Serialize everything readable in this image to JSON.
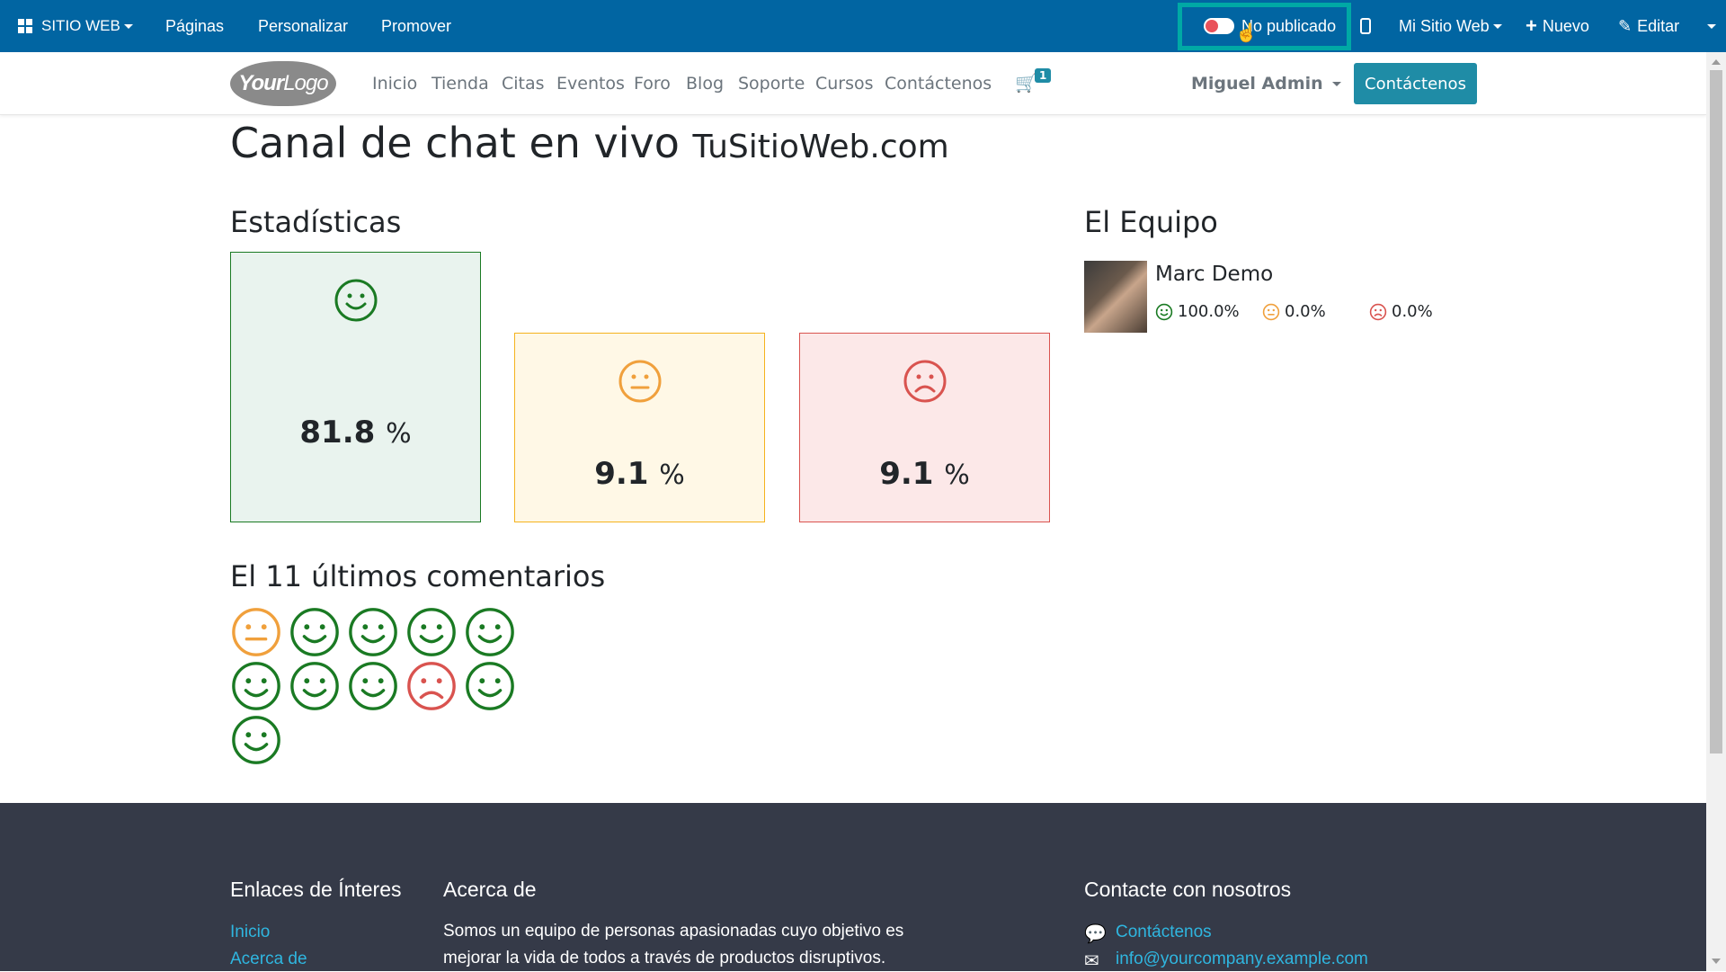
{
  "topbar": {
    "site_menu": "SITIO WEB",
    "pages": "Páginas",
    "customize": "Personalizar",
    "promote": "Promover",
    "publish_status": "No publicado",
    "my_site": "Mi Sitio Web",
    "new": "Nuevo",
    "edit": "Editar"
  },
  "navbar": {
    "logo_bold": "Your",
    "logo_rest": "Logo",
    "links": [
      "Inicio",
      "Tienda",
      "Citas",
      "Eventos",
      "Foro",
      "Blog",
      "Soporte",
      "Cursos",
      "Contáctenos"
    ],
    "cart_count": "1",
    "user": "Miguel Admin",
    "cta": "Contáctenos"
  },
  "page": {
    "title": "Canal de chat en vivo",
    "subtitle": "TuSitioWeb.com",
    "stats_heading": "Estadísticas",
    "stats": [
      {
        "value": "81.8",
        "unit": "%",
        "type": "happy"
      },
      {
        "value": "9.1",
        "unit": "%",
        "type": "neutral"
      },
      {
        "value": "9.1",
        "unit": "%",
        "type": "sad"
      }
    ],
    "team_heading": "El Equipo",
    "team": {
      "name": "Marc Demo",
      "happy": "100.0%",
      "neutral": "0.0%",
      "sad": "0.0%"
    },
    "comments_heading": "El 11 últimos comentarios",
    "comments": [
      "neutral",
      "happy",
      "happy",
      "happy",
      "happy",
      "happy",
      "happy",
      "happy",
      "sad",
      "happy",
      "happy"
    ]
  },
  "footer": {
    "links_heading": "Enlaces de Ínteres",
    "links": [
      "Inicio",
      "Acerca de"
    ],
    "about_heading": "Acerca de",
    "about_line1": "Somos un equipo de personas apasionadas cuyo objetivo es",
    "about_line2": "mejorar la vida de todos a través de productos disruptivos.",
    "contact_heading": "Contacte con nosotros",
    "contact_link": "Contáctenos",
    "contact_email": "info@yourcompany.example.com"
  },
  "colors": {
    "happy": "#1a7a23",
    "neutral": "#f0a03c",
    "sad": "#d9534f",
    "topbar": "#0165a2",
    "accent": "#1f8ca6"
  }
}
